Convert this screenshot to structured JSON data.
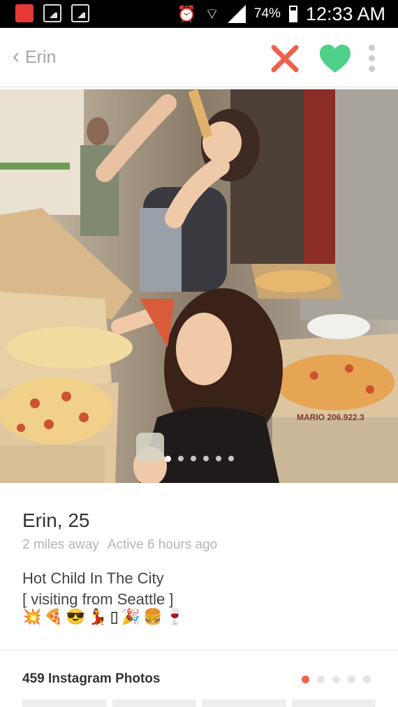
{
  "status_bar": {
    "battery_pct": "74%",
    "time": "12:33 AM",
    "icons": [
      "lock-notification-icon",
      "image-notification-icon",
      "picture-notification-icon",
      "alarm-icon",
      "wifi-icon",
      "signal-icon",
      "battery-icon"
    ]
  },
  "header": {
    "back_icon": "chevron-left-icon",
    "title": "Erin",
    "actions": [
      "nope-x-icon",
      "like-heart-icon",
      "more-vertical-icon"
    ]
  },
  "colors": {
    "nope": "#f0604a",
    "like": "#4ed08a",
    "accent_dot": "#f0604a"
  },
  "photo": {
    "pager_count": 6,
    "pager_active": 0,
    "sign_text": "MARIO 206.922.3"
  },
  "profile": {
    "name_age": "Erin, 25",
    "distance": "2 miles away",
    "active": "Active 6 hours ago",
    "bio_line1": "Hot Child In The City",
    "bio_line2": "[ visiting from Seattle ]",
    "emojis": [
      "💥",
      "🍕",
      "😎",
      "💃",
      "▯",
      "🎉",
      "🍔",
      "🍷"
    ]
  },
  "instagram": {
    "label": "459 Instagram Photos",
    "page_count": 5,
    "page_active": 0
  }
}
